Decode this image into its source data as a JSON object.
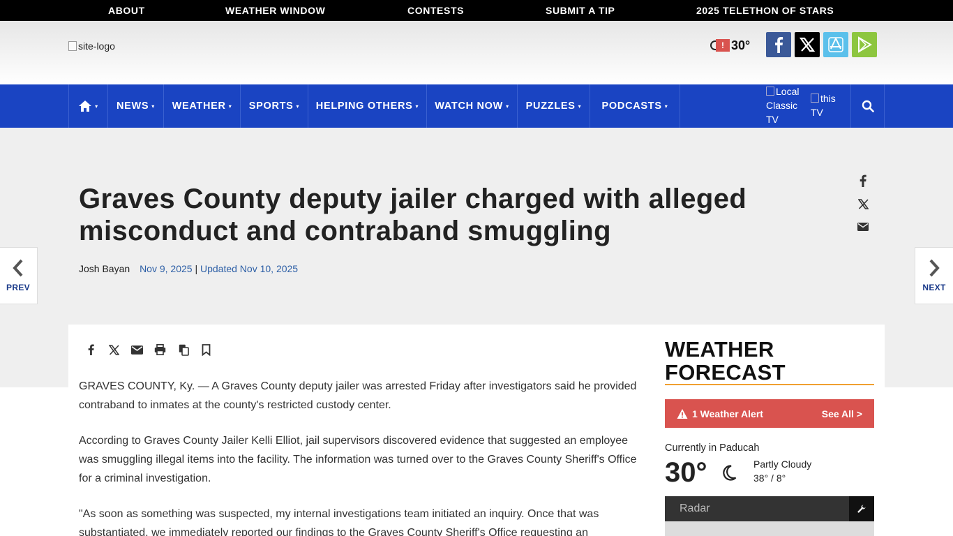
{
  "topbar": {
    "links": [
      "ABOUT",
      "WEATHER WINDOW",
      "CONTESTS",
      "SUBMIT A TIP",
      "2025 TELETHON OF STARS"
    ]
  },
  "header": {
    "logo_alt": "site-logo",
    "weather_temp": "30°",
    "alert_symbol": "!",
    "social": [
      {
        "name": "facebook",
        "color": "#3b5998"
      },
      {
        "name": "x",
        "color": "#000000"
      },
      {
        "name": "app-store",
        "color": "#5bc0eb"
      },
      {
        "name": "google-play",
        "color": "#8dc63f"
      }
    ]
  },
  "nav": {
    "items": [
      "NEWS",
      "WEATHER",
      "SPORTS",
      "HELPING OTHERS",
      "WATCH NOW",
      "PUZZLES",
      "PODCASTS"
    ],
    "caret": "▾",
    "promo1_lines": [
      "Local",
      "Classic",
      "TV"
    ],
    "promo2_lines": [
      "this",
      "TV"
    ],
    "color": "#1a44c2"
  },
  "article": {
    "headline": "Graves County deputy jailer charged with alleged misconduct and contraband smuggling",
    "author": "Josh Bayan",
    "published": "Nov 9, 2025",
    "separator": "|",
    "updated": "Updated Nov 10, 2025",
    "paragraphs": [
      "GRAVES COUNTY, Ky. — A Graves County deputy jailer was arrested Friday after investigators said he provided contraband to inmates at the county's restricted custody center.",
      "According to Graves County Jailer Kelli Elliot, jail supervisors discovered evidence that suggested an employee was smuggling illegal items into the facility. The information was turned over to the Graves County Sheriff's Office for a criminal investigation.",
      "\"As soon as something was suspected, my internal investigations team initiated an inquiry. Once that was substantiated, we immediately reported our findings to the Graves County Sheriff's Office requesting an"
    ]
  },
  "pager": {
    "prev": "PREV",
    "next": "NEXT"
  },
  "weather": {
    "title": "WEATHER FORECAST",
    "alert": "1 Weather Alert",
    "see_all": "See All >",
    "location": "Currently in Paducah",
    "temp": "30°",
    "condition": "Partly Cloudy",
    "range": "38° / 8°",
    "radar_placeholder": "Radar",
    "alert_color": "#d9534f",
    "accent_color": "#f0a030"
  }
}
